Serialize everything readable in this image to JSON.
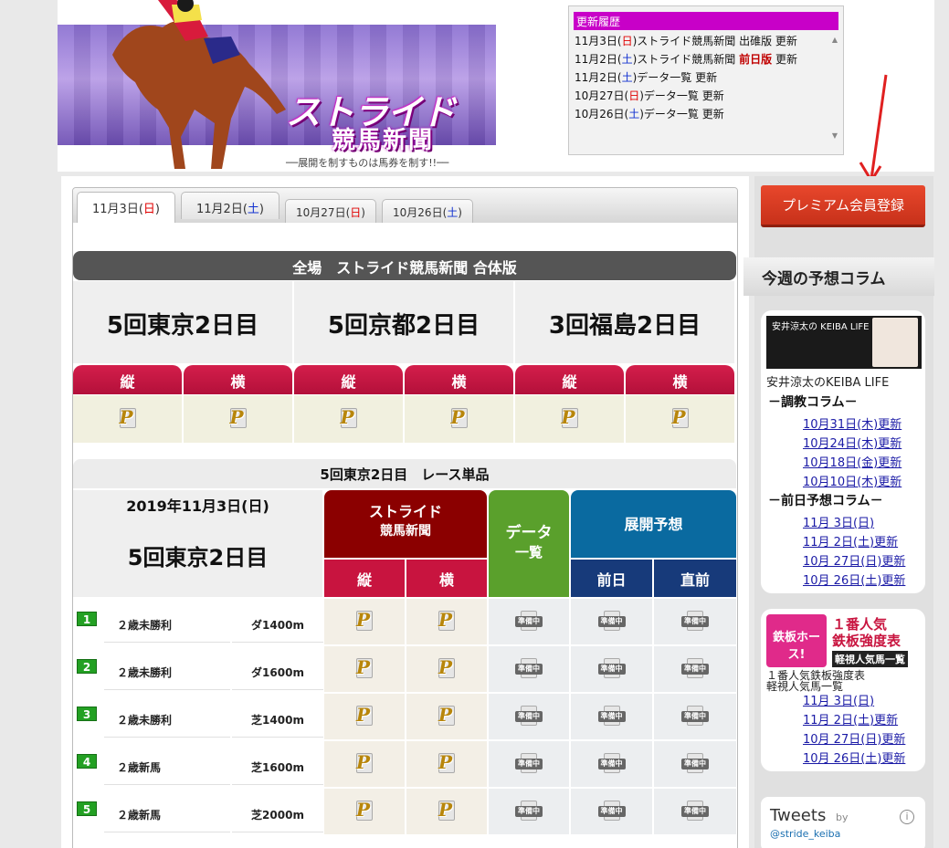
{
  "banner": {
    "logo_line1": "ストライド",
    "logo_line2": "競馬新聞",
    "tagline": "──展開を制すものは馬券を制す!!──"
  },
  "updates": {
    "title": "更新履歴",
    "items": [
      {
        "date": "11月3日(",
        "day": "日",
        "rest": ")ストライド競馬新聞 出碓版 更新",
        "dayType": "sun"
      },
      {
        "date": "11月2日(",
        "day": "土",
        "rest": ")ストライド競馬新聞 ",
        "badge": "前日版",
        "rest2": " 更新",
        "dayType": "sat"
      },
      {
        "date": "11月2日(",
        "day": "土",
        "rest": ")データ一覧 更新",
        "dayType": "sat"
      },
      {
        "date": "10月27日(",
        "day": "日",
        "rest": ")データ一覧 更新",
        "dayType": "sun"
      },
      {
        "date": "10月26日(",
        "day": "土",
        "rest": ")データ一覧 更新",
        "dayType": "sat"
      }
    ]
  },
  "tabs": [
    {
      "pre": "11月3日(",
      "day": "日",
      "post": ")",
      "dayType": "sun",
      "active": true
    },
    {
      "pre": "11月2日(",
      "day": "土",
      "post": ")",
      "dayType": "sat"
    },
    {
      "pre": "10月27日(",
      "day": "日",
      "post": ")",
      "dayType": "sun"
    },
    {
      "pre": "10月26日(",
      "day": "土",
      "post": ")",
      "dayType": "sat"
    }
  ],
  "combined_title": "全場　ストライド競馬新聞 合体版",
  "venues": [
    "5回東京2日目",
    "5回京都2日目",
    "3回福島2日目"
  ],
  "orient": {
    "tate": "縦",
    "yoko": "横"
  },
  "race_section_title": "5回東京2日目　レース単品",
  "race_date": "2019年11月3日(日)",
  "race_venue": "5回東京2日目",
  "col_stride": "ストライド",
  "col_stride2": "競馬新聞",
  "col_data": "データ",
  "col_data2": "一覧",
  "col_tenkai": "展開予想",
  "col_zenjitsu": "前日",
  "col_chokuzen": "直前",
  "preparing": "準備中",
  "races": [
    {
      "num": "1",
      "name": "２歳未勝利",
      "dist": "ダ1400m"
    },
    {
      "num": "2",
      "name": "２歳未勝利",
      "dist": "ダ1600m"
    },
    {
      "num": "3",
      "name": "２歳未勝利",
      "dist": "芝1400m"
    },
    {
      "num": "4",
      "name": "２歳新馬",
      "dist": "芝1600m"
    },
    {
      "num": "5",
      "name": "２歳新馬",
      "dist": "芝2000m"
    }
  ],
  "sidebar": {
    "premium": "プレミアム会員登録",
    "column_heading": "今週の予想コラム",
    "card1": {
      "img_title": "安井涼太の KEIBA LIFE",
      "caption": "安井涼太のKEIBA LIFE",
      "sec1": "－調教コラム－",
      "links1": [
        "10月31日(木)更新",
        "10月24日(木)更新",
        "10月18日(金)更新",
        "10月10日(木)更新"
      ],
      "sec2": "－前日予想コラム－",
      "links2": [
        "11月 3日(日)",
        "11月 2日(土)更新",
        "10月 27日(日)更新",
        "10月 26日(土)更新"
      ]
    },
    "card2": {
      "img_left": "鉄板ホース!",
      "img_right1": "１番人気",
      "img_right2": "鉄板強度表",
      "img_right3": "軽視人気馬一覧",
      "caption1": "１番人気鉄板強度表",
      "caption2": "軽視人気馬一覧",
      "links": [
        "11月 3日(日)",
        "11月 2日(土)更新",
        "10月 27日(日)更新",
        "10月 26日(土)更新"
      ]
    },
    "tweets": "Tweets",
    "tweets_by": "by",
    "tweets_handle": "@stride_keiba"
  },
  "colors": {
    "accent_red": "#c8143f",
    "stride_red": "#8b0000",
    "data_green": "#5aa02c",
    "tenkai_blue": "#0a6aa0",
    "premium": "#d93a22",
    "update_title": "#c800c8"
  }
}
